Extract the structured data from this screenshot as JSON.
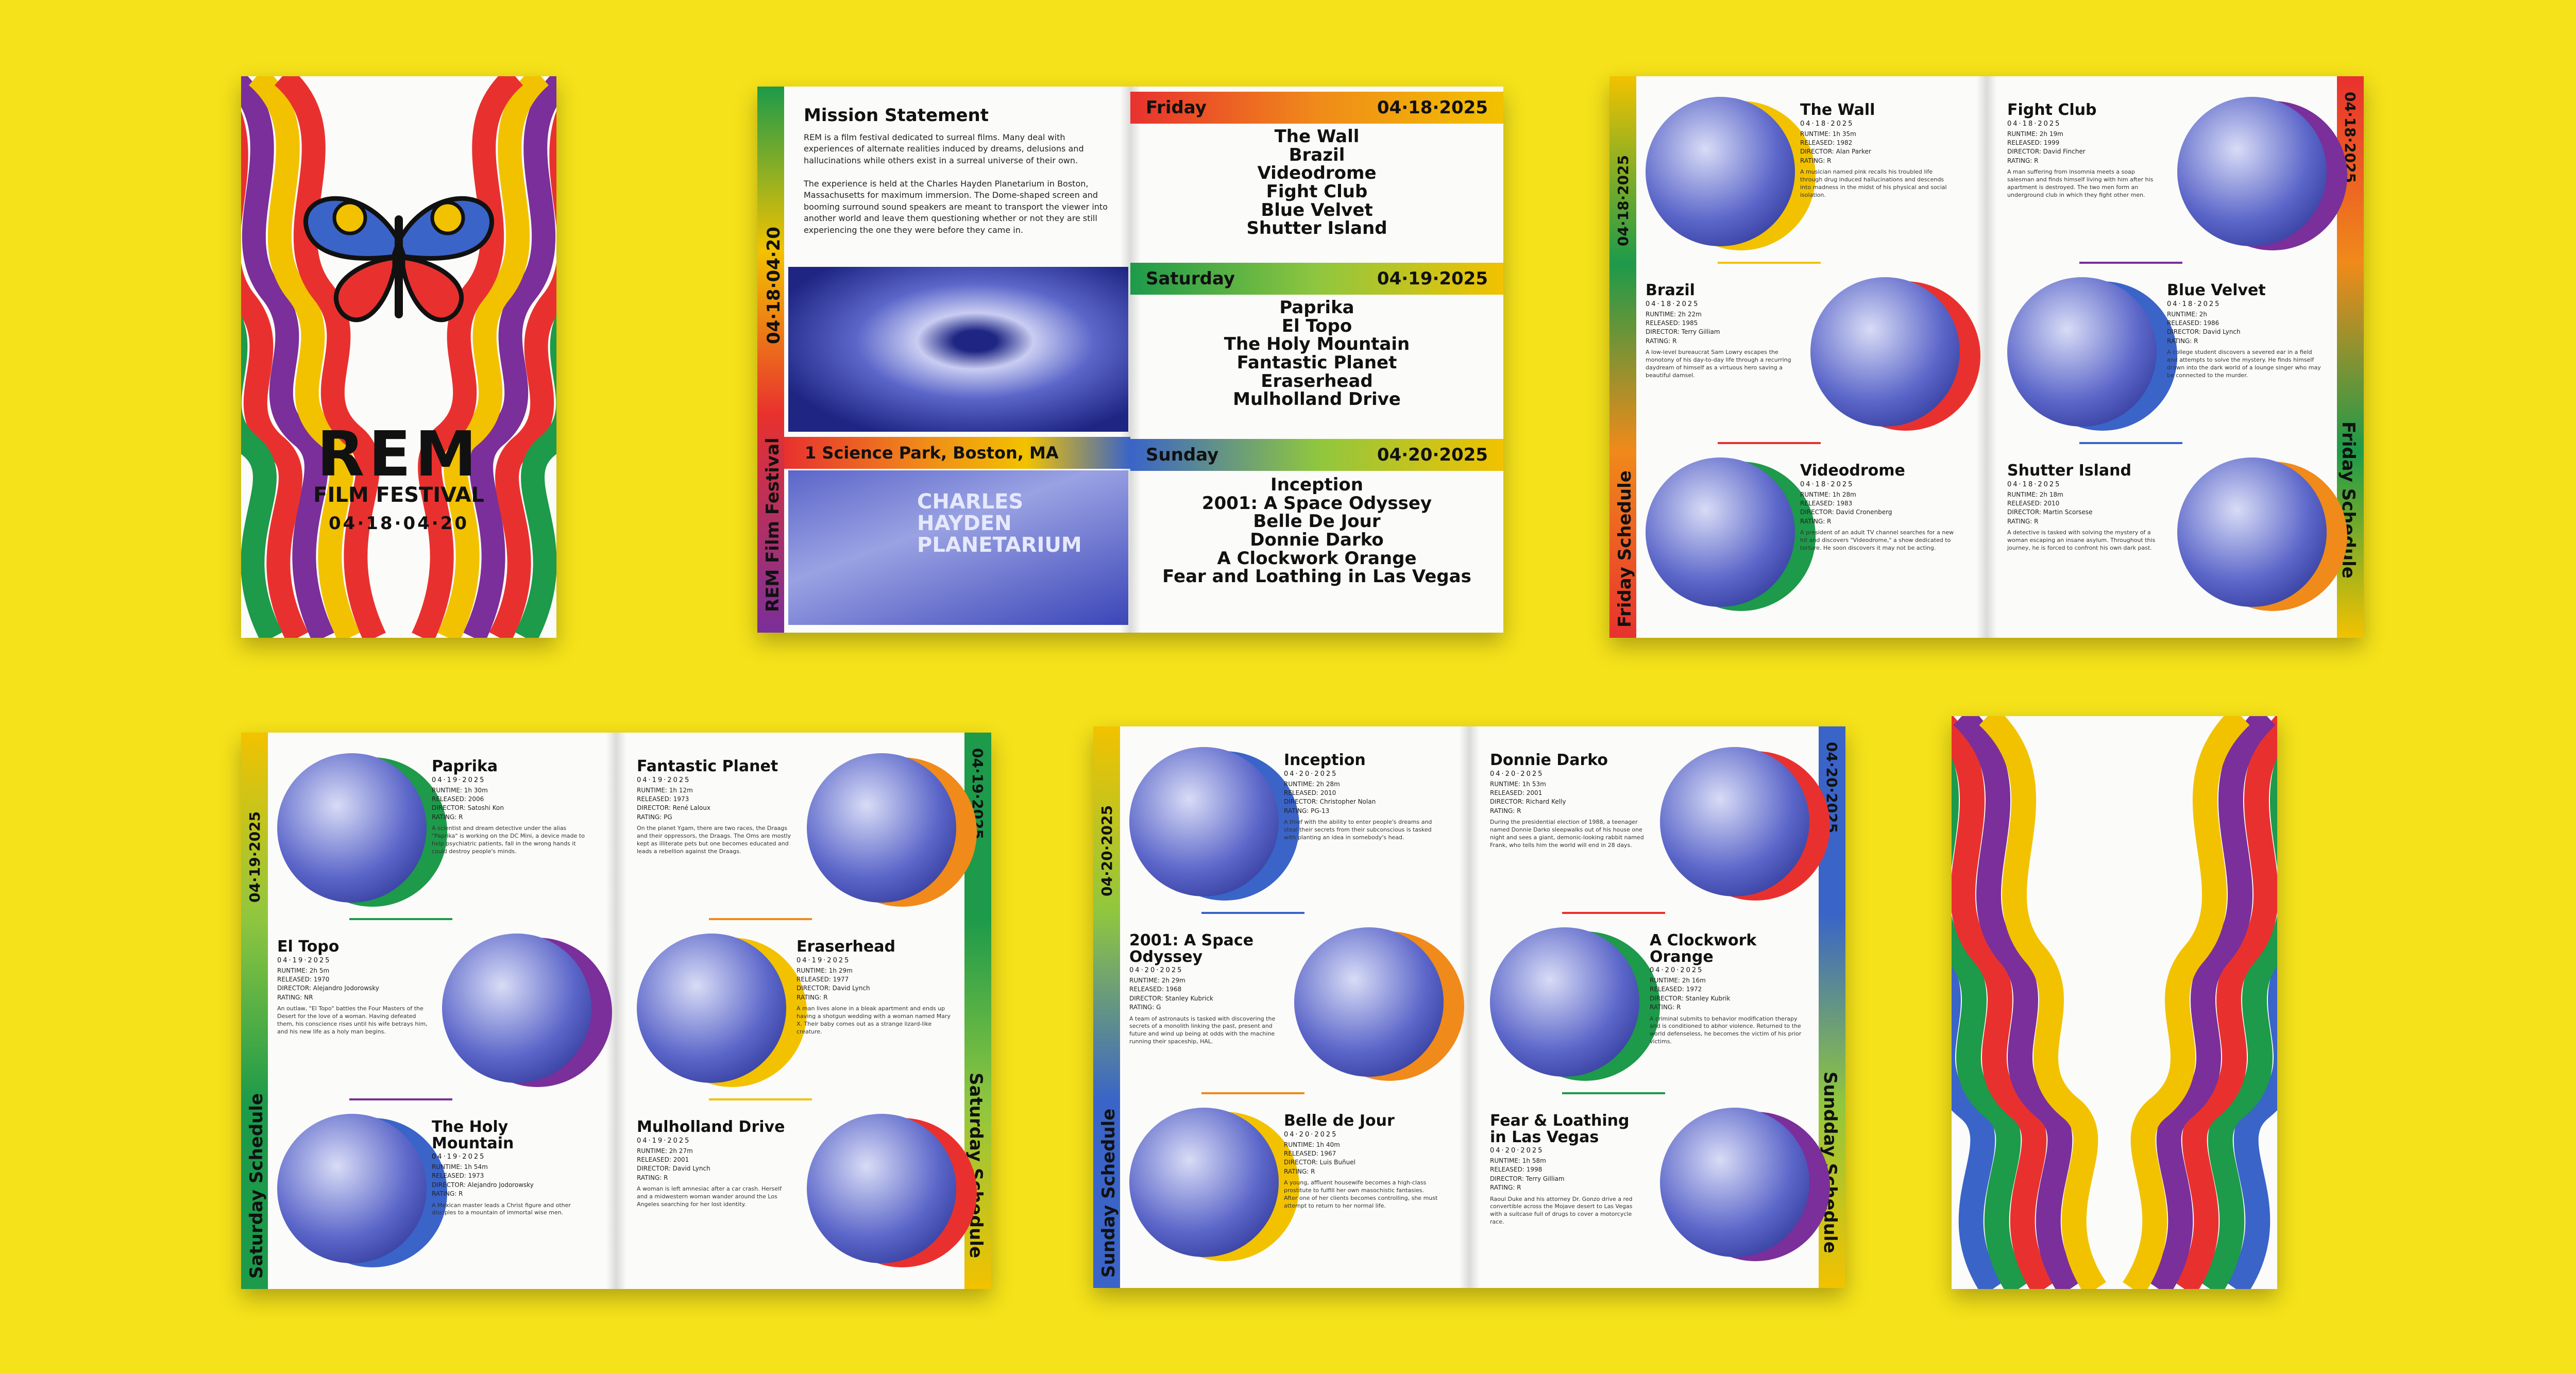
{
  "cover": {
    "title": "REM",
    "subtitle": "FILM FESTIVAL",
    "dates": "04·18·04·20"
  },
  "info": {
    "mission_heading": "Mission Statement",
    "mission_p1": "REM is a film festival dedicated to surreal films. Many deal with experiences of alternate realities induced by dreams, delusions and hallucinations while others exist in a surreal universe of their own.",
    "mission_p2": "The experience is held at the Charles Hayden Planetarium in Boston, Massachusetts for maximum immersion. The Dome-shaped screen and booming surround sound speakers are meant to transport the viewer into another world and leave them questioning whether or not they are still experiencing the one they were before they came in.",
    "address": "1 Science Park, Boston, MA",
    "side_label": "REM Film Festival",
    "side_dates": "04·18·04·20",
    "planetarium_sign": "CHARLES HAYDEN PLANETARIUM",
    "days": [
      {
        "name": "Friday",
        "date": "04·18·2025",
        "films": [
          "The Wall",
          "Brazil",
          "Videodrome",
          "Fight Club",
          "Blue Velvet",
          "Shutter Island"
        ]
      },
      {
        "name": "Saturday",
        "date": "04·19·2025",
        "films": [
          "Paprika",
          "El Topo",
          "The Holy Mountain",
          "Fantastic Planet",
          "Eraserhead",
          "Mulholland Drive"
        ]
      },
      {
        "name": "Sunday",
        "date": "04·20·2025",
        "films": [
          "Inception",
          "2001: A Space Odyssey",
          "Belle De Jour",
          "Donnie Darko",
          "A Clockwork Orange",
          "Fear and Loathing in Las Vegas"
        ]
      }
    ]
  },
  "schedules": {
    "friday": {
      "label_left": "Friday Schedule",
      "label_right": "Friday Schedule",
      "date": "04·18·2025",
      "films": [
        {
          "title": "The Wall",
          "runtime": "RUNTIME: 1h 35m",
          "released": "RELEASED: 1982",
          "director": "DIRECTOR: Alan Parker",
          "rating": "RATING: R",
          "desc": "A musician named pink recalls his troubled life through drug induced hallucinations and descends into madness in the midst of his physical and social isolation."
        },
        {
          "title": "Brazil",
          "runtime": "RUNTIME: 2h 22m",
          "released": "RELEASED: 1985",
          "director": "DIRECTOR: Terry Gilliam",
          "rating": "RATING: R",
          "desc": "A low-level bureaucrat Sam Lowry escapes the monotony of his day-to-day life through a recurring daydream of himself as a virtuous hero saving a beautiful damsel."
        },
        {
          "title": "Videodrome",
          "runtime": "RUNTIME: 1h 28m",
          "released": "RELEASED: 1983",
          "director": "DIRECTOR: David Cronenberg",
          "rating": "RATING: R",
          "desc": "A president of an adult TV channel searches for a new hit and discovers \"Videodrome,\" a show dedicated to torture. He soon discovers it may not be acting."
        },
        {
          "title": "Fight Club",
          "runtime": "RUNTIME: 2h 19m",
          "released": "RELEASED: 1999",
          "director": "DIRECTOR: David Fincher",
          "rating": "RATING: R",
          "desc": "A man suffering from insomnia meets a soap salesman and finds himself living with him after his apartment is destroyed. The two men form an underground club in which they fight other men."
        },
        {
          "title": "Blue Velvet",
          "runtime": "RUNTIME: 2h",
          "released": "RELEASED: 1986",
          "director": "DIRECTOR: David Lynch",
          "rating": "RATING: R",
          "desc": "A college student discovers a severed ear in a field and attempts to solve the mystery. He finds himself drawn into the dark world of a lounge singer who may be connected to the murder."
        },
        {
          "title": "Shutter Island",
          "runtime": "RUNTIME: 2h 18m",
          "released": "RELEASED: 2010",
          "director": "DIRECTOR: Martin Scorsese",
          "rating": "RATING: R",
          "desc": "A detective is tasked with solving the mystery of a woman escaping an insane asylum. Throughout this journey, he is forced to confront his own dark past."
        }
      ]
    },
    "saturday": {
      "label_left": "Saturday Schedule",
      "label_right": "Saturday Schedule",
      "date": "04·19·2025",
      "films": [
        {
          "title": "Paprika",
          "runtime": "RUNTIME: 1h 30m",
          "released": "RELEASED: 2006",
          "director": "DIRECTOR: Satoshi Kon",
          "rating": "RATING: R",
          "desc": "A scientist and dream detective under the alias \"Paprika\" is working on the DC Mini, a device made to help psychiatric patients, fall in the wrong hands it could destroy people's minds."
        },
        {
          "title": "El Topo",
          "runtime": "RUNTIME: 2h 5m",
          "released": "RELEASED: 1970",
          "director": "DIRECTOR: Alejandro Jodorowsky",
          "rating": "RATING: NR",
          "desc": "An outlaw, \"El Topo\" battles the Four Masters of the Desert for the love of a woman. Having defeated them, his conscience rises until his wife betrays him, and his new life as a holy man begins."
        },
        {
          "title": "The Holy Mountain",
          "runtime": "RUNTIME: 1h 54m",
          "released": "RELEASED: 1973",
          "director": "DIRECTOR: Alejandro Jodorowsky",
          "rating": "RATING: R",
          "desc": "A Mexican master leads a Christ figure and other disciples to a mountain of immortal wise men."
        },
        {
          "title": "Fantastic Planet",
          "runtime": "RUNTIME: 1h 12m",
          "released": "RELEASED: 1973",
          "director": "DIRECTOR: René Laloux",
          "rating": "RATING: PG",
          "desc": "On the planet Ygam, there are two races, the Draags and their oppressors, the Draags. The Oms are mostly kept as illiterate pets but one becomes educated and leads a rebellion against the Draags."
        },
        {
          "title": "Eraserhead",
          "runtime": "RUNTIME: 1h 29m",
          "released": "RELEASED: 1977",
          "director": "DIRECTOR: David Lynch",
          "rating": "RATING: R",
          "desc": "A man lives alone in a bleak apartment and ends up having a shotgun wedding with a woman named Mary X. Their baby comes out as a strange lizard-like creature."
        },
        {
          "title": "Mulholland Drive",
          "runtime": "RUNTIME: 2h 27m",
          "released": "RELEASED: 2001",
          "director": "DIRECTOR: David Lynch",
          "rating": "RATING: R",
          "desc": "A woman is left amnesiac after a car crash. Herself and a midwestern woman wander around the Los Angeles searching for her lost identity."
        }
      ]
    },
    "sunday": {
      "label_left": "Sunday Schedule",
      "label_right": "Sundday Schedule",
      "date": "04·20·2025",
      "films": [
        {
          "title": "Inception",
          "runtime": "RUNTIME: 2h 28m",
          "released": "RELEASED: 2010",
          "director": "DIRECTOR: Christopher Nolan",
          "rating": "RATING: PG-13",
          "desc": "A thief with the ability to enter people's dreams and steal their secrets from their subconscious is tasked with planting an idea in somebody's head."
        },
        {
          "title": "2001: A Space Odyssey",
          "runtime": "RUNTIME: 2h 29m",
          "released": "RELEASED: 1968",
          "director": "DIRECTOR: Stanley Kubrick",
          "rating": "RATING: G",
          "desc": "A team of astronauts is tasked with discovering the secrets of a monolith linking the past, present and future and wind up being at odds with the machine running their spaceship, HAL."
        },
        {
          "title": "Belle de Jour",
          "runtime": "RUNTIME: 1h 40m",
          "released": "RELEASED: 1967",
          "director": "DIRECTOR: Luis Buñuel",
          "rating": "RATING: R",
          "desc": "A young, affluent housewife becomes a high-class prostitute to fulfill her own masochistic fantasies. After one of her clients becomes controlling, she must attempt to return to her normal life."
        },
        {
          "title": "Donnie Darko",
          "runtime": "RUNTIME: 1h 53m",
          "released": "RELEASED: 2001",
          "director": "DIRECTOR: Richard Kelly",
          "rating": "RATING: R",
          "desc": "During the presidential election of 1988, a teenager named Donnie Darko sleepwalks out of his house one night and sees a giant, demonic-looking rabbit named Frank, who tells him the world will end in 28 days."
        },
        {
          "title": "A Clockwork Orange",
          "runtime": "RUNTIME: 2h 16m",
          "released": "RELEASED: 1972",
          "director": "DIRECTOR: Stanley Kubrik",
          "rating": "RATING: R",
          "desc": "A criminal submits to behavior modification therapy and is conditioned to abhor violence. Returned to the world defenseless, he becomes the victim of his prior victims."
        },
        {
          "title": "Fear & Loathing in Las Vegas",
          "runtime": "RUNTIME: 1h 58m",
          "released": "RELEASED: 1998",
          "director": "DIRECTOR: Terry Gilliam",
          "rating": "RATING: R",
          "desc": "Raoul Duke and his attorney Dr. Gonzo drive a red convertible across the Mojave desert to Las Vegas with a suitcase full of drugs to cover a motorcycle race."
        }
      ]
    }
  },
  "colors": {
    "background": "#f5e21a",
    "red": "#e8312e",
    "orange": "#f08a1a",
    "yellow": "#f2c200",
    "green": "#1d9a4a",
    "lime": "#8fc63f",
    "blue": "#3a64c8",
    "purple": "#7a2f9a",
    "photo": "#3b46b8"
  }
}
